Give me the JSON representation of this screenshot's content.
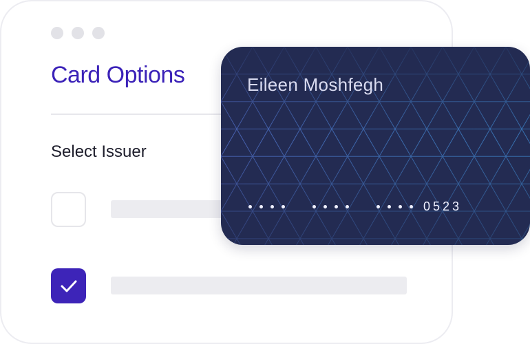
{
  "window": {
    "dots_icon": "window-controls"
  },
  "panel": {
    "title": "Card Options",
    "subtitle": "Select Issuer",
    "options": [
      {
        "checked": false
      },
      {
        "checked": true
      }
    ]
  },
  "card": {
    "holder_name": "Eileen Moshfegh",
    "last4": "0523"
  },
  "colors": {
    "title_gradient_start": "#3b22b8",
    "title_gradient_end": "#5a40df",
    "checkbox_checked": "#3d24b8",
    "card_background": "#232b52"
  }
}
